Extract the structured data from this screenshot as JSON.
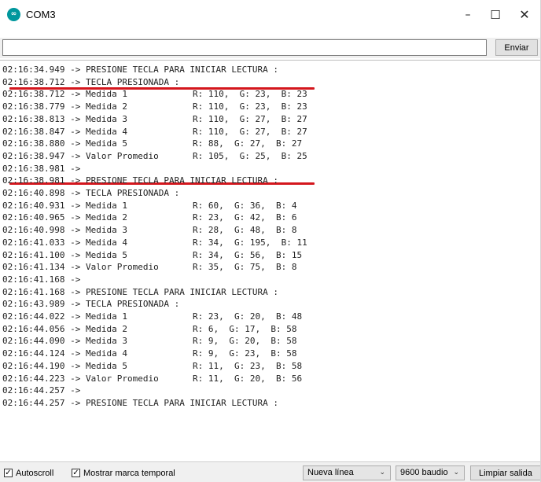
{
  "window": {
    "title": "COM3",
    "app_icon": "arduino-icon",
    "controls": {
      "minimize": "–",
      "maximize": "☐",
      "close": "✕"
    }
  },
  "send": {
    "value": "",
    "button_label": "Enviar"
  },
  "log": [
    {
      "ts": "02:16:34.949",
      "arrow": " -> ",
      "msg": "PRESIONE TECLA PARA INICIAR LECTURA :",
      "vals": ""
    },
    {
      "ts": "02:16:38.712",
      "arrow": " -> ",
      "msg": "TECLA PRESIONADA :",
      "vals": ""
    },
    {
      "ts": "02:16:38.712",
      "arrow": " -> ",
      "msg": "Medida 1",
      "vals": "R: 110,  G: 23,  B: 23"
    },
    {
      "ts": "02:16:38.779",
      "arrow": " -> ",
      "msg": "Medida 2",
      "vals": "R: 110,  G: 23,  B: 23"
    },
    {
      "ts": "02:16:38.813",
      "arrow": " -> ",
      "msg": "Medida 3",
      "vals": "R: 110,  G: 27,  B: 27"
    },
    {
      "ts": "02:16:38.847",
      "arrow": " -> ",
      "msg": "Medida 4",
      "vals": "R: 110,  G: 27,  B: 27"
    },
    {
      "ts": "02:16:38.880",
      "arrow": " -> ",
      "msg": "Medida 5",
      "vals": "R: 88,  G: 27,  B: 27"
    },
    {
      "ts": "02:16:38.947",
      "arrow": " -> ",
      "msg": "Valor Promedio",
      "vals": "R: 105,  G: 25,  B: 25"
    },
    {
      "ts": "02:16:38.981",
      "arrow": " ->",
      "msg": "",
      "vals": ""
    },
    {
      "ts": "02:16:38.981",
      "arrow": " -> ",
      "msg": "PRESIONE TECLA PARA INICIAR LECTURA :",
      "vals": ""
    },
    {
      "ts": "02:16:40.898",
      "arrow": " -> ",
      "msg": "TECLA PRESIONADA :",
      "vals": ""
    },
    {
      "ts": "02:16:40.931",
      "arrow": " -> ",
      "msg": "Medida 1",
      "vals": "R: 60,  G: 36,  B: 4"
    },
    {
      "ts": "02:16:40.965",
      "arrow": " -> ",
      "msg": "Medida 2",
      "vals": "R: 23,  G: 42,  B: 6"
    },
    {
      "ts": "02:16:40.998",
      "arrow": " -> ",
      "msg": "Medida 3",
      "vals": "R: 28,  G: 48,  B: 8"
    },
    {
      "ts": "02:16:41.033",
      "arrow": " -> ",
      "msg": "Medida 4",
      "vals": "R: 34,  G: 195,  B: 11"
    },
    {
      "ts": "02:16:41.100",
      "arrow": " -> ",
      "msg": "Medida 5",
      "vals": "R: 34,  G: 56,  B: 15"
    },
    {
      "ts": "02:16:41.134",
      "arrow": " -> ",
      "msg": "Valor Promedio",
      "vals": "R: 35,  G: 75,  B: 8"
    },
    {
      "ts": "02:16:41.168",
      "arrow": " ->",
      "msg": "",
      "vals": ""
    },
    {
      "ts": "02:16:41.168",
      "arrow": " -> ",
      "msg": "PRESIONE TECLA PARA INICIAR LECTURA :",
      "vals": ""
    },
    {
      "ts": "02:16:43.989",
      "arrow": " -> ",
      "msg": "TECLA PRESIONADA :",
      "vals": ""
    },
    {
      "ts": "02:16:44.022",
      "arrow": " -> ",
      "msg": "Medida 1",
      "vals": "R: 23,  G: 20,  B: 48"
    },
    {
      "ts": "02:16:44.056",
      "arrow": " -> ",
      "msg": "Medida 2",
      "vals": "R: 6,  G: 17,  B: 58"
    },
    {
      "ts": "02:16:44.090",
      "arrow": " -> ",
      "msg": "Medida 3",
      "vals": "R: 9,  G: 20,  B: 58"
    },
    {
      "ts": "02:16:44.124",
      "arrow": " -> ",
      "msg": "Medida 4",
      "vals": "R: 9,  G: 23,  B: 58"
    },
    {
      "ts": "02:16:44.190",
      "arrow": " -> ",
      "msg": "Medida 5",
      "vals": "R: 11,  G: 23,  B: 58"
    },
    {
      "ts": "02:16:44.223",
      "arrow": " -> ",
      "msg": "Valor Promedio",
      "vals": "R: 11,  G: 20,  B: 56"
    },
    {
      "ts": "02:16:44.257",
      "arrow": " ->",
      "msg": "",
      "vals": ""
    },
    {
      "ts": "02:16:44.257",
      "arrow": " -> ",
      "msg": "PRESIONE TECLA PARA INICIAR LECTURA :",
      "vals": ""
    }
  ],
  "annotation_color": "#d4161d",
  "status": {
    "autoscroll": {
      "label": "Autoscroll",
      "checked": true,
      "mark": "✓"
    },
    "timestamp": {
      "label": "Mostrar marca temporal",
      "checked": true,
      "mark": "✓"
    },
    "line_ending": "Nueva línea",
    "baud": "9600 baudio",
    "clear_label": "Limpiar salida",
    "chevron": "⌄"
  }
}
